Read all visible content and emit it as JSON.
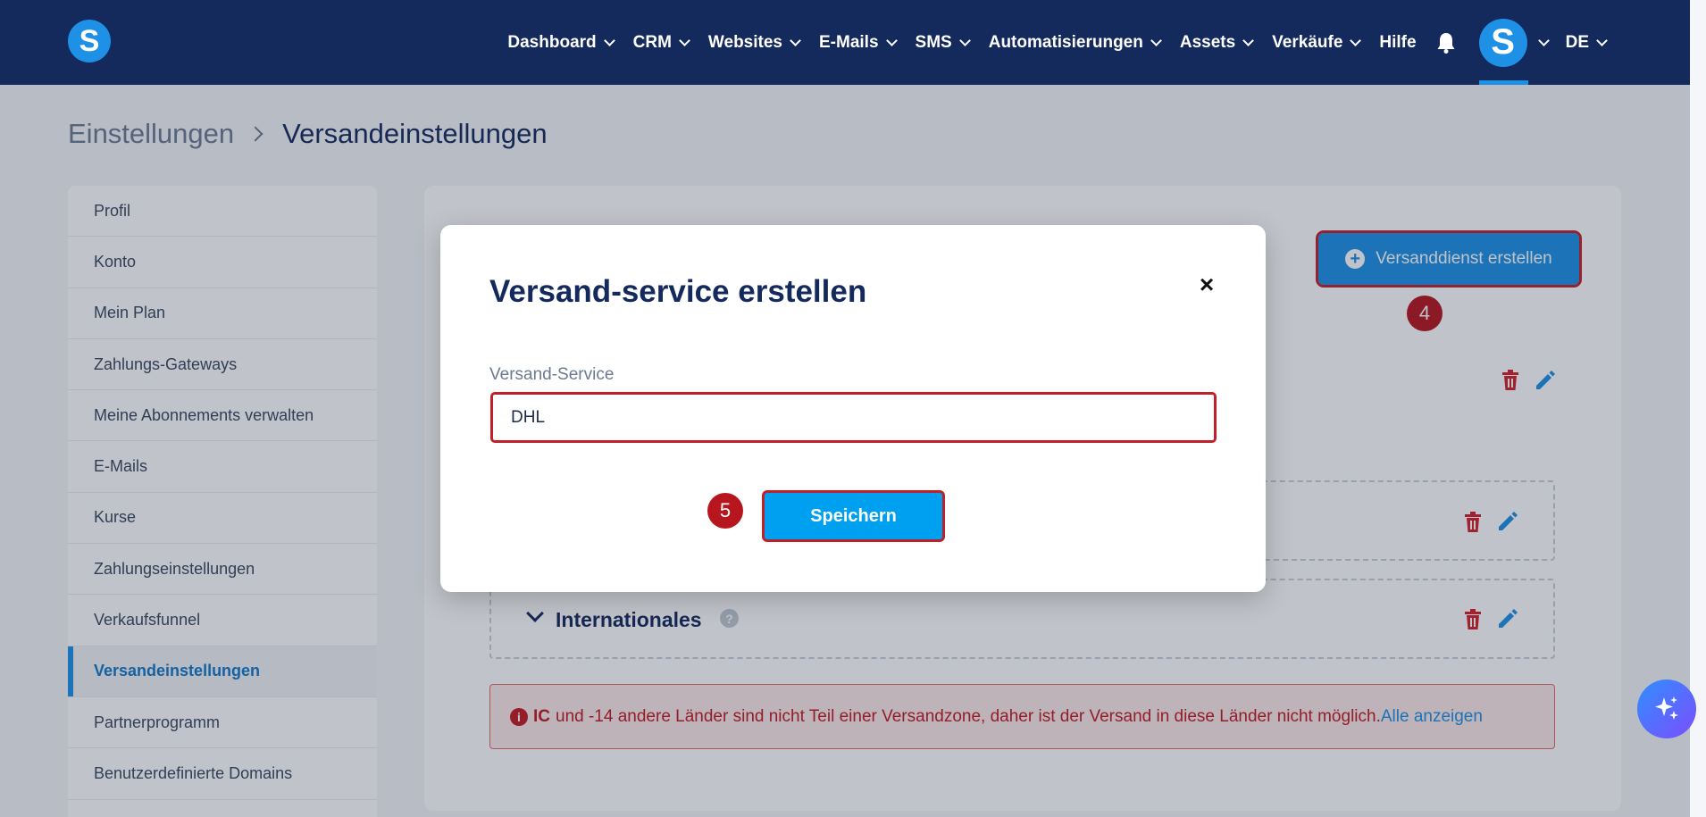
{
  "app": {
    "logo_letter": "S"
  },
  "nav": {
    "items": [
      {
        "label": "Dashboard",
        "dropdown": true
      },
      {
        "label": "CRM",
        "dropdown": true
      },
      {
        "label": "Websites",
        "dropdown": true
      },
      {
        "label": "E-Mails",
        "dropdown": true
      },
      {
        "label": "SMS",
        "dropdown": true
      },
      {
        "label": "Automatisierungen",
        "dropdown": true
      },
      {
        "label": "Assets",
        "dropdown": true
      },
      {
        "label": "Verkäufe",
        "dropdown": true
      },
      {
        "label": "Hilfe",
        "dropdown": false
      }
    ],
    "notifications_icon": "bell-icon",
    "avatar_letter": "S",
    "language": "DE"
  },
  "breadcrumb": {
    "parent": "Einstellungen",
    "current": "Versandeinstellungen"
  },
  "sidebar": {
    "items": [
      {
        "label": "Profil"
      },
      {
        "label": "Konto"
      },
      {
        "label": "Mein Plan"
      },
      {
        "label": "Zahlungs-Gateways"
      },
      {
        "label": "Meine Abonnements verwalten"
      },
      {
        "label": "E-Mails"
      },
      {
        "label": "Kurse"
      },
      {
        "label": "Zahlungseinstellungen"
      },
      {
        "label": "Verkaufsfunnel"
      },
      {
        "label": "Versandeinstellungen",
        "active": true
      },
      {
        "label": "Partnerprogramm"
      },
      {
        "label": "Benutzerdefinierte Domains"
      }
    ]
  },
  "main": {
    "create_button": "Versanddienst erstellen",
    "zone_title": "Internationales",
    "zone_help": "?",
    "alert": {
      "icon": "i",
      "bold": "IC",
      "text": "und -14 andere Länder sind nicht Teil einer Versandzone, daher ist der Versand in diese Länder nicht möglich.",
      "link": "Alle anzeigen"
    }
  },
  "annotations": {
    "step_create": "4",
    "step_save": "5"
  },
  "modal": {
    "title": "Versand-service erstellen",
    "close": "×",
    "field_label": "Versand-Service",
    "field_value": "DHL",
    "save_button": "Speichern"
  },
  "colors": {
    "nav_bg": "#14295c",
    "accent": "#1e90e6",
    "highlight": "#c0202a",
    "delete": "#d3202a"
  }
}
